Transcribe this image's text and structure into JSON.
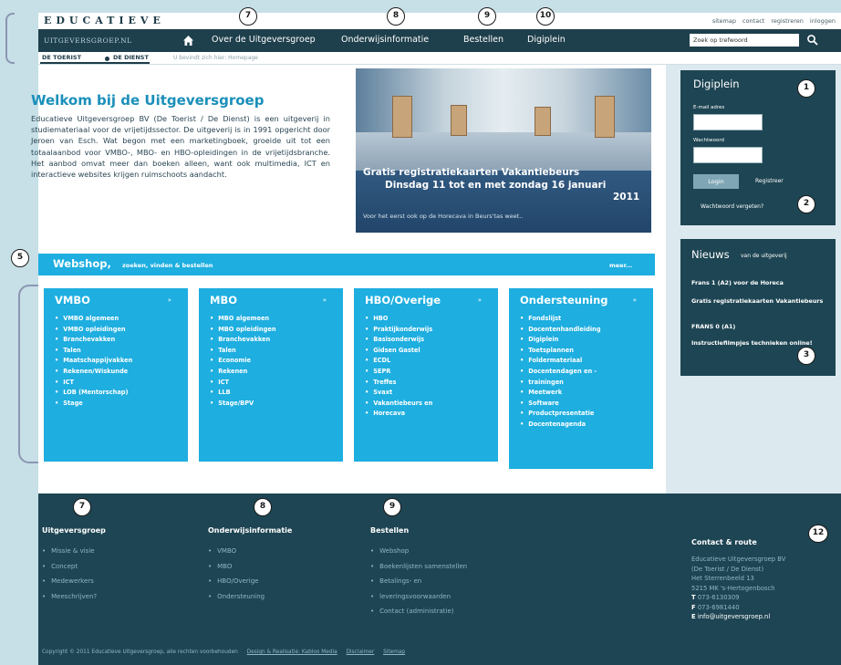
{
  "header": {
    "logo_text": "EDUCATIEVE",
    "top_links": [
      "sitemap",
      "contact",
      "registreren",
      "inloggen"
    ]
  },
  "nav": {
    "site_name": "UITGEVERSGROEP.NL",
    "items": [
      "Over de Uitgeversgroep",
      "Onderwijsinformatie",
      "Bestellen",
      "Digiplein"
    ],
    "search_placeholder": "Zoek op trefwoord"
  },
  "subbar": {
    "brand_left": "DE TOERIST",
    "brand_right": "DE DIENST",
    "breadcrumb": "U bevindt zich hier: Homepage"
  },
  "welcome": {
    "title": "Welkom bij de Uitgeversgroep",
    "text": "Educatieve Uitgeversgroep BV (De Toerist / De Dienst) is een uitgeverij in studiemateriaal voor de vrijetijdssector. De uitgeverij is in 1991 opgericht door Jeroen van Esch. Wat begon met een marketingboek, groeide uit tot een totaalaanbod voor VMBO-, MBO- en HBO-opleidingen in de vrijetijdsbranche. Het aanbod omvat meer dan boeken alleen, want ook multimedia, ICT en interactieve websites krijgen ruimschoots aandacht."
  },
  "hero": {
    "line1": "Gratis registratiekaarten Vakantiebeurs",
    "line2": "Dinsdag 11 tot en met zondag 16 januari",
    "line3": "2011",
    "small": "Voor het eerst ook op de Horecava in Beurs'tas weet.."
  },
  "webshop": {
    "title": "Webshop,",
    "subtitle": "zoeken, vinden & bestellen",
    "more": "meer..."
  },
  "categories": [
    {
      "title": "VMBO",
      "items": [
        "VMBO algemeen",
        "VMBO opleidingen",
        "Branchevakken",
        "Talen",
        "Maatschappijvakken",
        "Rekenen/Wiskunde",
        "ICT",
        "LOB (Mentorschap)",
        "Stage"
      ]
    },
    {
      "title": "MBO",
      "items": [
        "MBO algemeen",
        "MBO opleidingen",
        "Branchevakken",
        "Talen",
        "Economie",
        "Rekenen",
        "ICT",
        "LLB",
        "Stage/BPV"
      ]
    },
    {
      "title": "HBO/Overige",
      "items": [
        "HBO",
        "Praktijkonderwijs",
        "Basisonderwijs",
        "Gidsen Gastel",
        "ECDL",
        "SEPR",
        "Treffes",
        "Svaxt",
        "Vakantiebeurs en",
        "Horecava"
      ]
    },
    {
      "title": "Ondersteuning",
      "items": [
        "Fondslijst",
        "Docentenhandleiding",
        "Digiplein",
        "Toetsplannen",
        "Foldermateriaal",
        "Docentendagen en -",
        "trainingen",
        "Meetwerk",
        "Software",
        "Productpresentatie",
        "Docentenagenda"
      ]
    }
  ],
  "login": {
    "title": "Digiplein",
    "email_label": "E-mail adres",
    "password_label": "Wachtwoord",
    "login_button": "Login",
    "register": "Registreer",
    "forgot": "Wachtwoord vergeten?"
  },
  "news": {
    "title": "Nieuws",
    "subtitle": "van de uitgeverij",
    "items": [
      "Frans 1 (A2) voor de Horeca",
      "Gratis registratiekaarten Vakantiebeurs",
      "FRANS 0 (A1)",
      "Instructiefilmpjes technieken online!"
    ]
  },
  "footer": {
    "columns": [
      {
        "title": "Uitgeversgroep",
        "items": [
          "Missie & visie",
          "Concept",
          "Medewerkers",
          "Meeschrijven?"
        ]
      },
      {
        "title": "Onderwijsinformatie",
        "items": [
          "VMBO",
          "MBO",
          "HBO/Overige",
          "Ondersteuning"
        ]
      },
      {
        "title": "Bestellen",
        "items": [
          "Webshop",
          "Boekenlijsten samenstellen",
          "Betalings- en",
          "leveringsvoorwaarden",
          "Contact (administratie)"
        ]
      }
    ],
    "contact_title": "Contact & route",
    "contact_lines": [
      "Educatieve Uitgeversgroep BV",
      "(De Toerist / De Dienst)",
      "Het Sterrenbeeld 13",
      "5215 MK 's-Hertogenbosch"
    ],
    "phone": "073-6130309",
    "fax": "073-6981440",
    "email": "info@uitgeversgroep.nl",
    "copyright": "Copyright © 2011 Educatieve Uitgeversgroep, alle rechten voorbehouden",
    "links": [
      "Design & Realisatie: Kabloo Media",
      "Disclaimer",
      "Sitemap"
    ]
  },
  "callouts": [
    "1",
    "2",
    "3",
    "5",
    "7",
    "8",
    "9",
    "10",
    "12"
  ]
}
